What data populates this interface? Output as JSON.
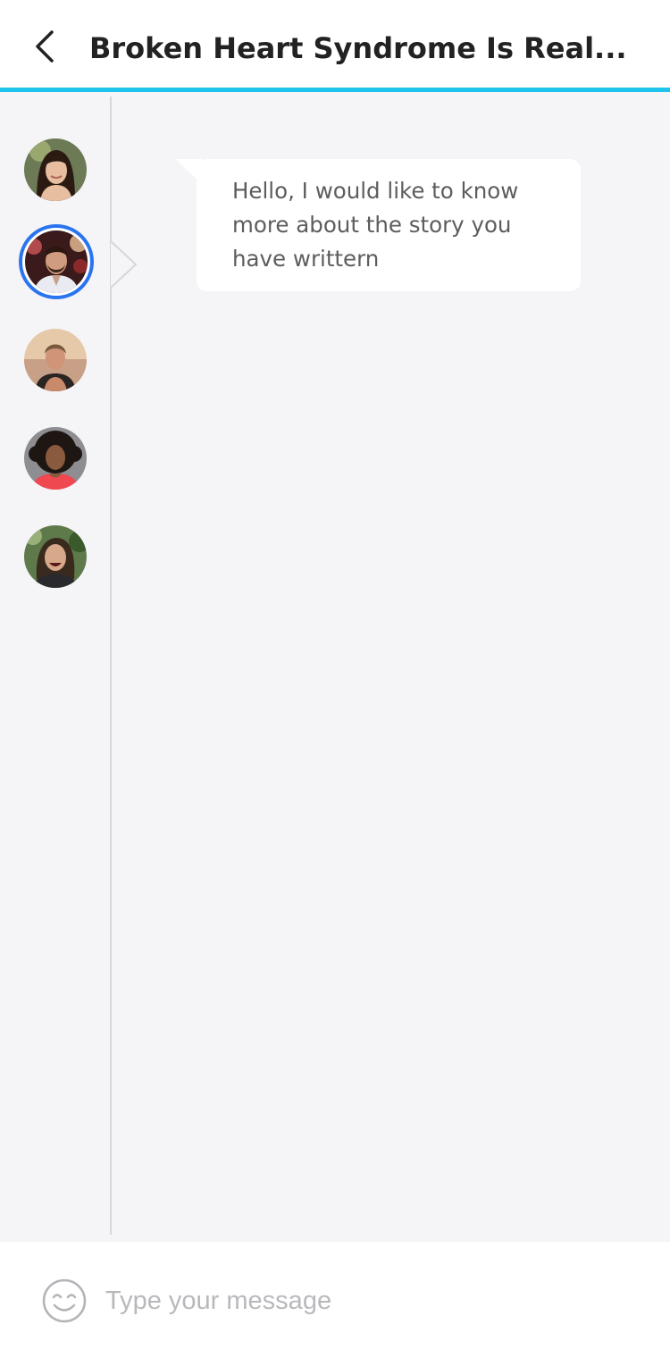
{
  "header": {
    "title": "Broken Heart Syndrome Is Real...",
    "back_icon": "chevron-left-icon",
    "accent_color": "#1ec3ee"
  },
  "sidebar": {
    "contacts": [
      {
        "name": "contact-1",
        "selected": false
      },
      {
        "name": "contact-2",
        "selected": true
      },
      {
        "name": "contact-3",
        "selected": false
      },
      {
        "name": "contact-4",
        "selected": false
      },
      {
        "name": "contact-5",
        "selected": false
      }
    ],
    "selected_ring_color": "#2a74f0"
  },
  "conversation": {
    "messages": [
      {
        "text": "Hello, I would like to know more about the story you have writtern"
      }
    ]
  },
  "composer": {
    "placeholder": "Type your message",
    "value": "",
    "emoji_icon": "smiley-icon"
  }
}
